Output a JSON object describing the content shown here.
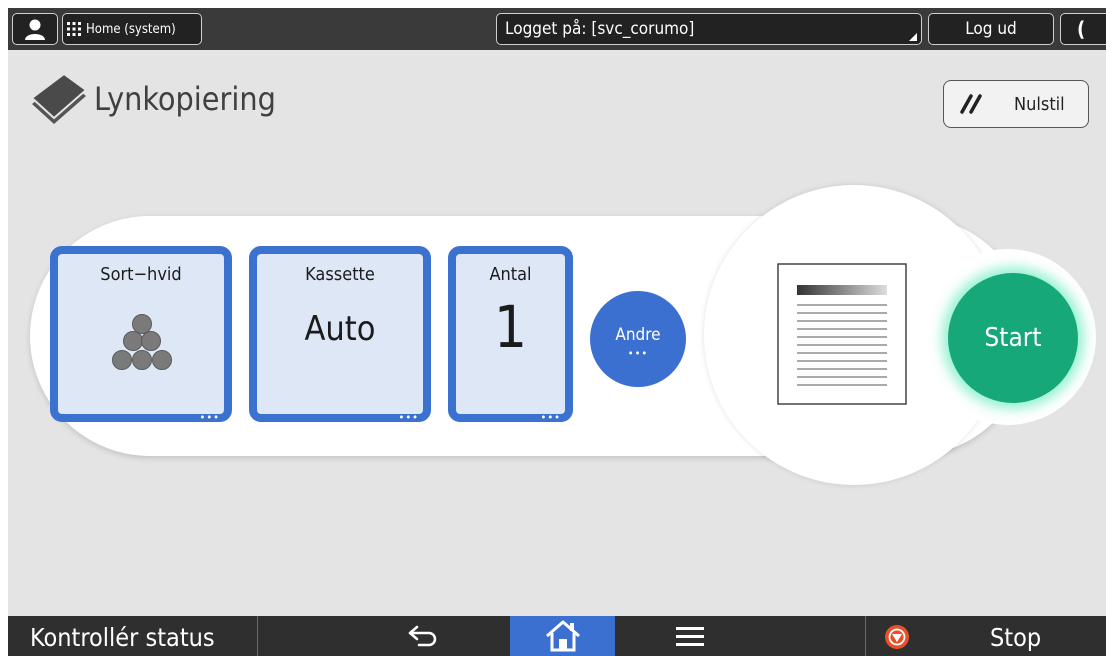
{
  "topbar": {
    "user_icon": "person-icon",
    "home_label": "Home (system)",
    "login_label": "Logget på: [svc_corumo]",
    "logout_label": "Log ud",
    "moon_label": "("
  },
  "header": {
    "title": "Lynkopiering",
    "app_icon": "stacked-pages-icon",
    "reset_label": "Nulstil",
    "reset_icon": "double-slash-icon"
  },
  "tiles": {
    "color": {
      "label": "Sort−hvid",
      "icon": "toner-balls-icon",
      "more": "•••"
    },
    "tray": {
      "label": "Kassette",
      "value": "Auto",
      "more": "•••"
    },
    "quantity": {
      "label": "Antal",
      "value": "1",
      "more": "•••"
    }
  },
  "other": {
    "label": "Andre",
    "more": "•••"
  },
  "preview": {
    "icon": "document-preview-icon"
  },
  "start": {
    "label": "Start"
  },
  "bottombar": {
    "status_label": "Kontrollér status",
    "back_icon": "back-arrow-icon",
    "home_icon": "home-icon",
    "menu_icon": "hamburger-menu-icon",
    "stop_icon": "stop-icon",
    "stop_label": "Stop"
  },
  "colors": {
    "tile_border": "#3b72cf",
    "tile_fill": "#dde7f6",
    "start_green": "#16a878",
    "topbar": "#3a3a3a",
    "bottombar": "#2f2f2f",
    "background": "#e4e4e4"
  }
}
